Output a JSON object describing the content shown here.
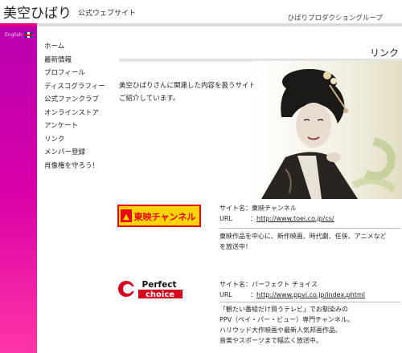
{
  "header": {
    "site_name": "美空ひばり",
    "site_sub": "公式ウェブサイト",
    "group": "ひばりプロダクショングループ"
  },
  "lang": {
    "english": "English"
  },
  "nav": [
    "ホーム",
    "最新情報",
    "プロフィール",
    "ディスコグラフィー",
    "公式ファンクラブ",
    "オンラインストア",
    "アンケート",
    "リンク",
    "メンバー登録",
    "肖像権を守ろう！"
  ],
  "page_title": "リンク",
  "intro": [
    "美空ひばりさんに関連した内容を扱うサイトを",
    "ご紹介しています。"
  ],
  "links": [
    {
      "logo_text": "東映チャンネル",
      "site_label": "サイト名：",
      "site_name": "東映チャンネル",
      "url_label": "URL",
      "url": "http://www.toei.co.jp/cs/",
      "desc": [
        "東映作品を中心に、新作映画、時代劇、任侠、アニメなど",
        "を放送中！"
      ]
    },
    {
      "logo_text_1": "Perfect",
      "logo_text_2": "choice",
      "site_label": "サイト名：",
      "site_name": "パーフェクト チョイス",
      "url_label": "URL",
      "url": "http://www.ppvi.co.jp/index.phtml",
      "desc": [
        "「観たい番組だけ買うテレビ」でお馴染みの",
        "PPV（ペイ・パー・ビュー）専門チャンネル。",
        "ハリウッド大作映画や最新人気邦画作品、",
        "音楽やスポーツまで幅広く放送中。"
      ]
    }
  ],
  "colors": {
    "sidebar_top": "#b800b0",
    "sidebar_bottom": "#ff36a6",
    "toei_red": "#e60012",
    "toei_yellow": "#ffd400",
    "perfect_red": "#d4001e"
  }
}
